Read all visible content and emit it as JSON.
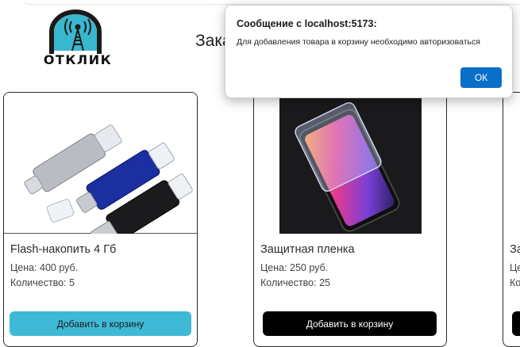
{
  "logo": {
    "text": "ОТКЛИК",
    "accent_color": "#39b7cf"
  },
  "heading": {
    "text": "Зака"
  },
  "products": [
    {
      "title": "Flash-накопить 4 Гб",
      "price": "Цена: 400 руб.",
      "quantity": "Количество: 5",
      "button": "Добавить в корзину",
      "button_color": "#3fb9d6"
    },
    {
      "title": "Защитная пленка",
      "price": "Цена: 250 руб.",
      "quantity": "Количество: 25",
      "button": "Добавить в корзину",
      "button_color": "#000000"
    },
    {
      "title": "За",
      "price": "Це",
      "quantity": "Ко",
      "button": "",
      "button_color": "#000000"
    }
  ],
  "dialog": {
    "title": "Сообщение с localhost:5173:",
    "message": "Для добавления товара в корзину необходимо авторизоваться",
    "ok_label": "ОК",
    "ok_color": "#0a6fc8"
  }
}
